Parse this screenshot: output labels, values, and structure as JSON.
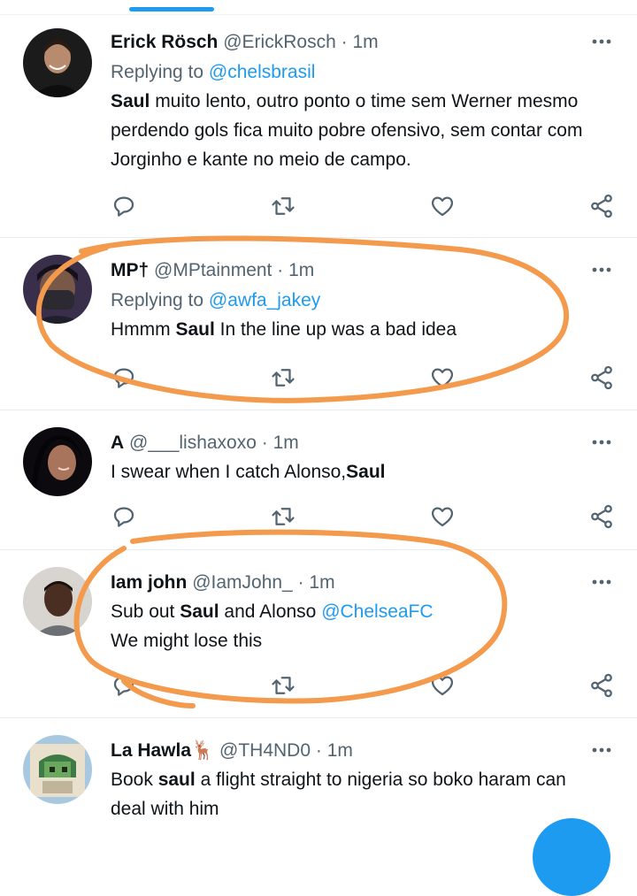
{
  "tweets": [
    {
      "name": "Erick Rösch",
      "handle": "@ErickRosch",
      "dot": "·",
      "time": "1m",
      "replying_prefix": "Replying to",
      "replying_to": "@chelsbrasil",
      "text_parts": [
        {
          "b": "Saul"
        },
        {
          "t": " muito lento, outro ponto o time sem Werner mesmo perdendo gols fica muito pobre ofensivo, sem contar com Jorginho e kante no meio de campo."
        }
      ]
    },
    {
      "name": "MP†",
      "handle": "@MPtainment",
      "dot": "·",
      "time": "1m",
      "replying_prefix": "Replying to",
      "replying_to": "@awfa_jakey",
      "text_parts": [
        {
          "t": "Hmmm "
        },
        {
          "b": "Saul"
        },
        {
          "t": " In the line up was a bad idea"
        }
      ]
    },
    {
      "name": "A",
      "handle": "@___lishaxoxo",
      "dot": "·",
      "time": "1m",
      "text_parts": [
        {
          "t": "I swear when I catch Alonso,"
        },
        {
          "b": "Saul"
        }
      ]
    },
    {
      "name": "Iam john",
      "handle": "@IamJohn_",
      "dot": "·",
      "time": "1m",
      "text_parts": [
        {
          "t": "Sub out "
        },
        {
          "b": "Saul"
        },
        {
          "t": " and Alonso "
        },
        {
          "m": "@ChelseaFC"
        },
        {
          "br": true
        },
        {
          "t": "We might lose this"
        }
      ]
    },
    {
      "name": "La Hawla🦌",
      "handle": "@TH4ND0",
      "dot": "·",
      "time": "1m",
      "text_parts": [
        {
          "t": "Book "
        },
        {
          "b": "saul"
        },
        {
          "t": " a flight straight to nigeria so boko haram can deal with him"
        }
      ]
    }
  ],
  "icons": {
    "reply": "reply-icon",
    "retweet": "retweet-icon",
    "like": "like-icon",
    "share": "share-icon",
    "more": "more-icon"
  },
  "colors": {
    "accent": "#1d9bf0",
    "secondary_text": "#536471",
    "annotation": "#f39a4d"
  }
}
